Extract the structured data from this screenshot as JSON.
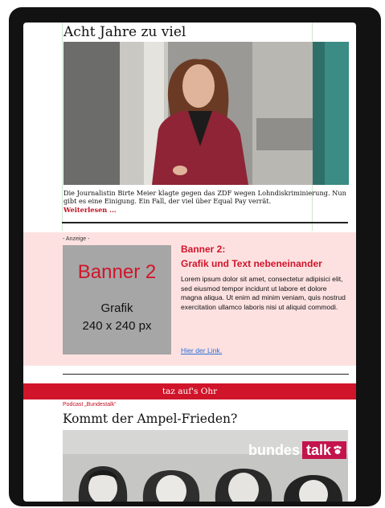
{
  "article": {
    "headline": "Acht Jahre zu viel",
    "caption": "Die Journalistin Birte Meier klagte gegen das ZDF wegen Lohndiskriminierung. Nun gibt es eine Einigung. Ein Fall, der viel über Equal Pay verrät.",
    "read_more": "Weiterlesen ..."
  },
  "ad": {
    "label": "- Anzeige -",
    "grafik_title": "Banner 2",
    "grafik_line1": "Grafik",
    "grafik_line2": "240 x 240 px",
    "title_line1": "Banner 2:",
    "title_line2": "Grafik und Text nebeneinander",
    "body": "Lorem ipsum dolor sit amet, consectetur adipisici elit, sed eiusmod tempor incidunt ut labore et dolore magna aliqua. Ut enim ad minim veniam, quis nostrud exercitation ullamco laboris nisi ut aliquid commodi.",
    "link": "Hier der Link."
  },
  "section_bar": "taz auf's Ohr",
  "podcast": {
    "kicker": "Podcast „Bundestalk“",
    "title": "Kommt der Ampel-Frieden?",
    "logo_part1": "bundes",
    "logo_part2": "talk"
  },
  "colors": {
    "accent": "#d0152a",
    "ad_background": "#fde1e1",
    "link": "#2a6fd6",
    "logo_bg": "#c3144c"
  }
}
